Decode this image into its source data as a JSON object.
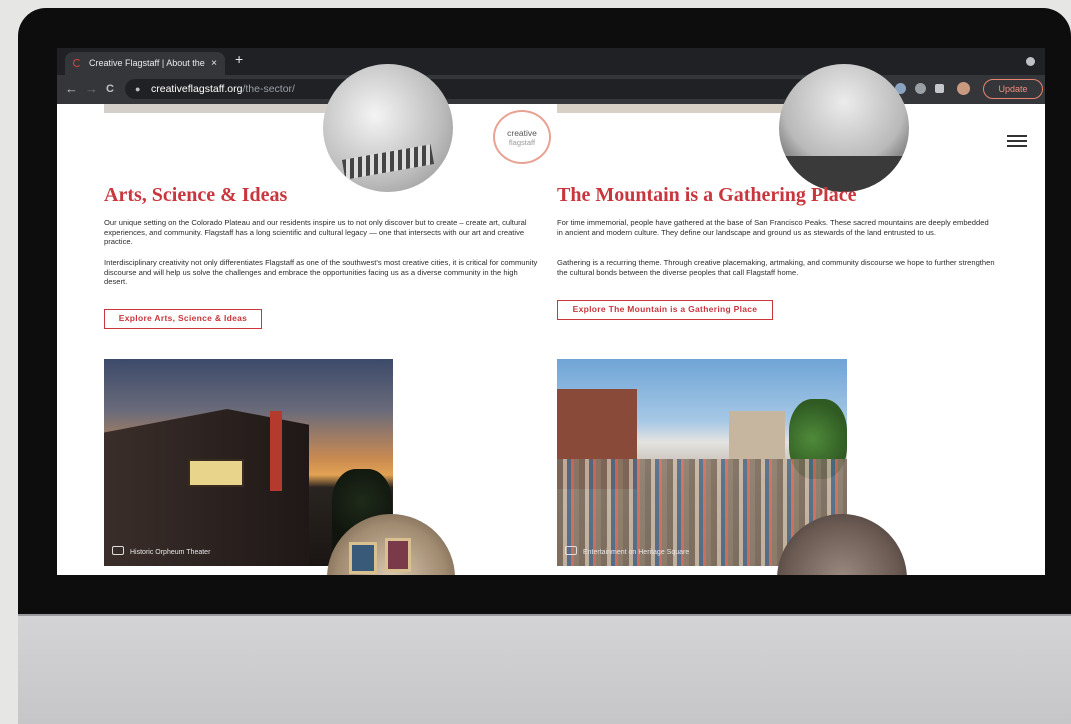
{
  "browser": {
    "tab_title": "Creative Flagstaff | About the S",
    "tab_close": "×",
    "new_tab": "+",
    "url_domain": "creativeflagstaff.org",
    "url_path": "/the-sector/",
    "update_label": "Update",
    "back": "←",
    "forward": "→",
    "reload": "C"
  },
  "logo": {
    "line1": "creative",
    "line2": "flagstaff"
  },
  "sections": {
    "left": {
      "heading": "Arts, Science & Ideas",
      "para1": "Our unique setting on the Colorado Plateau and our residents inspire us to not only discover but to create – create art, cultural experiences, and community. Flagstaff has a long scientific and cultural legacy — one that intersects with our art and creative practice.",
      "para2": "Interdisciplinary creativity not only differentiates Flagstaff as one of the southwest's most creative cities, it is critical for community discourse and will help us solve the challenges and embrace the opportunities facing us as a diverse community in the high desert.",
      "button": "Explore Arts, Science & Ideas",
      "caption": "Historic Orpheum Theater"
    },
    "right": {
      "heading": "The Mountain is a Gathering Place",
      "para1": "For time immemorial, people have gathered at the base of San Francisco Peaks. These sacred mountains are deeply embedded in ancient and modern culture. They define our landscape and ground us as stewards of the land entrusted to us.",
      "para2": "Gathering is a recurring theme. Through creative placemaking, artmaking, and community discourse we hope to further strengthen the cultural bonds between the diverse peoples that call Flagstaff home.",
      "button": "Explore The Mountain is a Gathering Place",
      "caption": "Entertainment on Heritage Square"
    }
  },
  "colors": {
    "accent": "#c9363e",
    "text": "#2d2d2d",
    "chrome_dark": "#202124",
    "chrome_toolbar": "#35363a"
  },
  "icons": [
    "camera-icon",
    "menu-icon",
    "lock-icon",
    "star-icon",
    "zoom-icon",
    "extensions-icon"
  ]
}
